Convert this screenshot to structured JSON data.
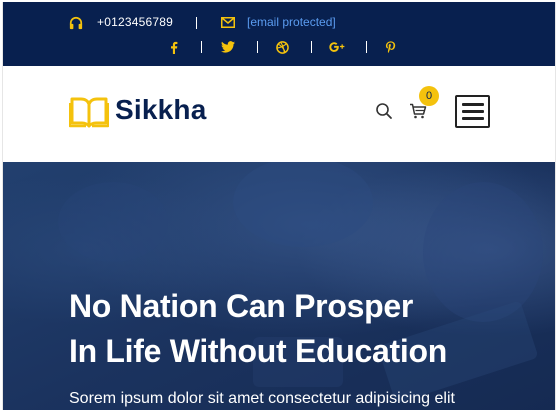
{
  "topbar": {
    "phone": "+0123456789",
    "email": "[email protected]",
    "social": [
      {
        "icon": "facebook-icon"
      },
      {
        "icon": "twitter-icon"
      },
      {
        "icon": "dribbble-icon"
      },
      {
        "icon": "google-plus-icon"
      },
      {
        "icon": "pinterest-icon"
      }
    ]
  },
  "header": {
    "brand": "Sikkha",
    "cart_count": "0",
    "icons": [
      "book-logo-icon",
      "search-icon",
      "cart-icon",
      "hamburger-menu-icon"
    ]
  },
  "hero": {
    "title_line1": "No Nation Can Prosper",
    "title_line2": "In Life Without Education",
    "subtitle": "Sorem ipsum dolor sit amet consectetur adipisicing elit"
  },
  "colors": {
    "navy": "#08204f",
    "accent": "#f4c20d",
    "link": "#5b9cf0",
    "hero_overlay": "#1c3463"
  }
}
